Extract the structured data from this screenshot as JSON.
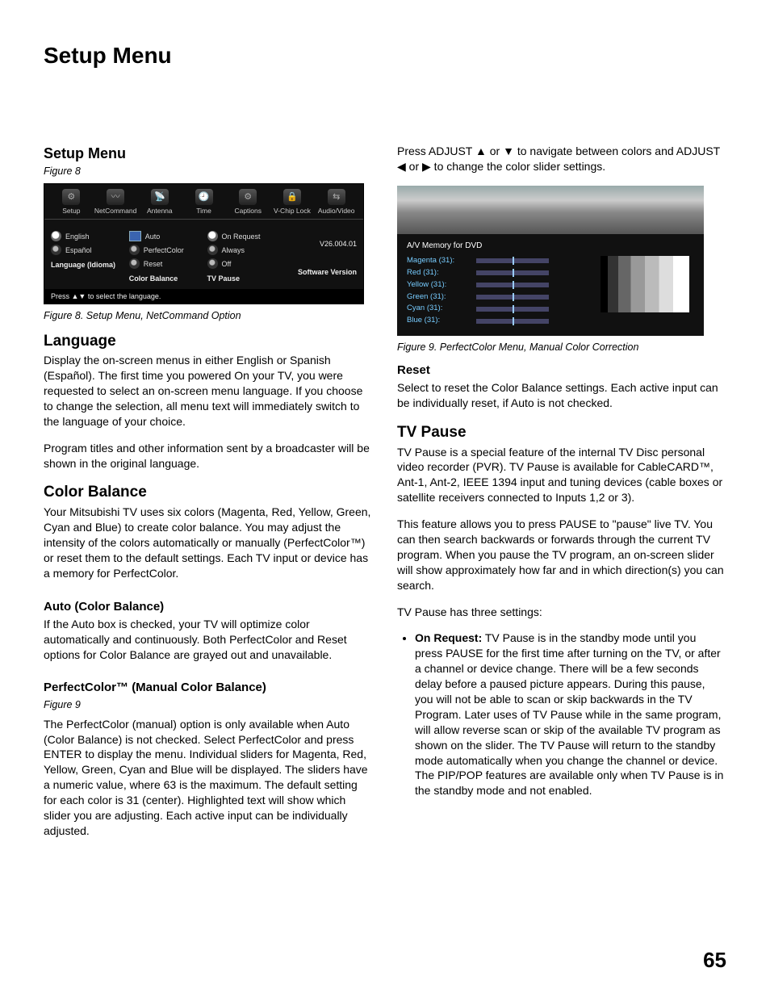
{
  "page_title": "Setup Menu",
  "page_number": "65",
  "left": {
    "menu_heading": "Setup Menu",
    "menu_figref": "Figure 8",
    "fig8_caption": "Figure 8. Setup Menu, NetCommand Option",
    "lang_h": "Language",
    "lang_p1": "Display the on-screen menus in either English or Spanish (Español).  The first time you powered On your TV, you were requested to select an on-screen menu language.  If you choose to change the selection, all menu text will immediately switch to the language of your choice.",
    "lang_p2": "Program titles and other information sent by a broadcaster will be shown in the original language.",
    "cb_h": "Color Balance",
    "cb_p1": "Your Mitsubishi TV uses six colors (Magenta, Red, Yellow, Green, Cyan and Blue) to create color balance.  You may adjust the intensity of the colors automatically or manually (PerfectColor™) or reset them to the default settings.  Each TV input or device has a memory for PerfectColor.",
    "auto_h": "Auto (Color Balance)",
    "auto_p1": "If the Auto box is checked, your TV will optimize color automatically and continuously.  Both PerfectColor and Reset options for Color Balance are grayed out and unavailable.",
    "pc_h": "PerfectColor™ (Manual Color Balance)",
    "pc_figref": "Figure 9",
    "pc_p1": "The PerfectColor (manual) option is only available when Auto (Color Balance) is not checked.  Select PerfectColor and press ENTER to display the menu.  Individual sliders for Magenta, Red, Yellow, Green, Cyan and Blue will be displayed.  The sliders have a numeric value, where 63 is the maximum. The default setting for each color is 31 (center).  Highlighted text will show which slider you are adjusting.   Each active input can be individually adjusted."
  },
  "right": {
    "adjust_p1_a": "Press ADJUST  ",
    "adjust_p1_b": " or ",
    "adjust_p1_c": " to navigate between colors and ADJUST ",
    "adjust_p1_d": " or ",
    "adjust_p1_e": "  to change the color slider settings.",
    "fig9_caption": "Figure 9.  PerfectColor Menu, Manual Color Correction",
    "reset_h": "Reset",
    "reset_p1": "Select to reset the Color Balance settings.  Each active input can be individually reset, if Auto is not checked.",
    "tvp_h": "TV Pause",
    "tvp_p1": "TV Pause is a special feature of the internal TV Disc personal video recorder  (PVR).  TV Pause is available for CableCARD™, Ant-1, Ant-2, IEEE 1394 input and tuning devices (cable boxes or satellite receivers connected to Inputs 1,2 or 3).",
    "tvp_p2": "This feature allows you to press PAUSE to \"pause\" live TV.  You can then search backwards or forwards through the current TV program.  When you pause the TV program, an on-screen slider will show approximately how far and in which direction(s) you can search.",
    "tvp_p3": "TV Pause has three settings:",
    "tvp_b1_label": "On Request:",
    "tvp_b1_text": "  TV Pause is in the standby mode until you press PAUSE for the first time after turning on the TV,  or after a channel or device change.  There will be a few seconds delay before a paused picture appears.  During this pause, you will not be able to scan or skip backwards in the TV Program.  Later uses of TV Pause while in the same program, will allow reverse scan or skip of the available TV program as shown on the slider.  The TV Pause will return to the standby mode automatically when you change the channel or device.   The PIP/POP features are available only when TV Pause is in the standby mode and not enabled."
  },
  "fig8": {
    "tabs": [
      "Setup",
      "NetCommand",
      "Antenna",
      "Time",
      "Captions",
      "V-Chip Lock",
      "Audio/Video"
    ],
    "icons": [
      "⚙",
      "〰",
      "📡",
      "🕘",
      "⚙",
      "🔒",
      "⇆"
    ],
    "lang": {
      "english": "English",
      "espanol": "Español",
      "title": "Language (Idioma)"
    },
    "cb": {
      "auto": "Auto",
      "pc": "PerfectColor",
      "reset": "Reset",
      "title": "Color Balance"
    },
    "tvp": {
      "onreq": "On Request",
      "always": "Always",
      "off": "Off",
      "title": "TV Pause"
    },
    "ver": {
      "num": "V26.004.01",
      "lbl": "Software Version"
    },
    "footer": "Press ▲▼ to select the language."
  },
  "fig9": {
    "mem": "A/V Memory for DVD",
    "rows": [
      "Magenta (31):",
      "Red (31):",
      "Yellow (31):",
      "Green (31):",
      "Cyan (31):",
      "Blue (31):"
    ]
  }
}
